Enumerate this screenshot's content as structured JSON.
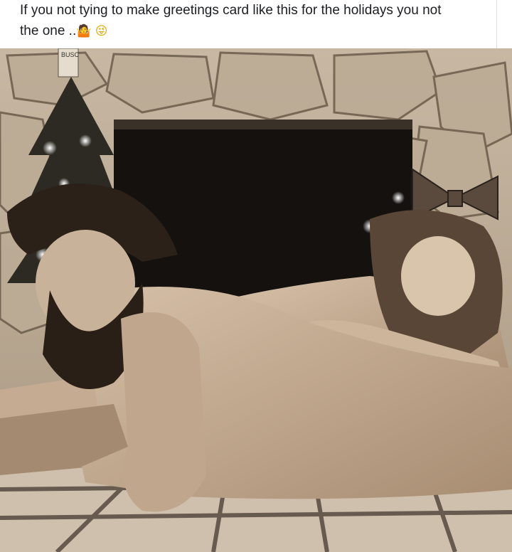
{
  "post": {
    "caption_line1": "If you not tying to make greetings card like this for the holidays you not",
    "caption_line2": "the one ..",
    "caption_emojis": [
      "woman-shrugging-emoji",
      "zany-face-emoji"
    ]
  },
  "photo": {
    "subject": "sepia holiday greeting photo",
    "tone_color": "#9b8a76",
    "can_label": "BUSC"
  }
}
